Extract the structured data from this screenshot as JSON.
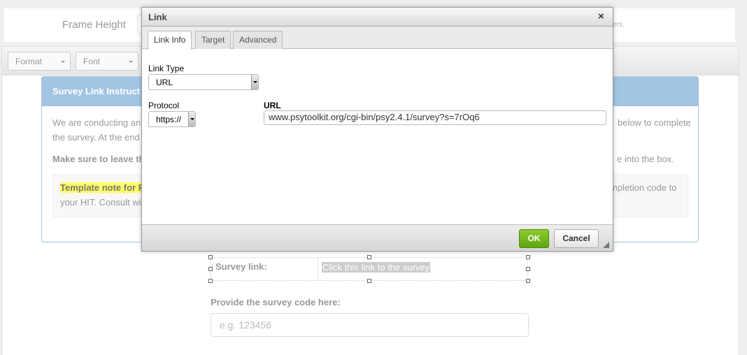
{
  "settings": {
    "frame_height_label": "Frame Height",
    "help_fragment": "ers."
  },
  "toolbar": {
    "format": "Format",
    "font": "Font"
  },
  "panel": {
    "title": "Survey Link Instruct",
    "line1_left": "We are conducting an",
    "line1_right": "below to complete",
    "line2_left": "the survey. At the end",
    "line3_left": "Make sure to leave th",
    "line3_right": "e into the box.",
    "note_left": "Template note for R",
    "note_right": "mpletion code to",
    "note2_left": "your HIT. Consult wi"
  },
  "survey": {
    "link_label": "Survey link:",
    "link_text": "Click this link to the survey",
    "code_label": "Provide the survey code here:",
    "code_placeholder": "e.g. 123456"
  },
  "dialog": {
    "title": "Link",
    "close": "×",
    "tabs": [
      {
        "label": "Link Info",
        "active": true
      },
      {
        "label": "Target"
      },
      {
        "label": "Advanced"
      }
    ],
    "link_type_label": "Link Type",
    "link_type_value": "URL",
    "protocol_label": "Protocol",
    "protocol_value": "https://",
    "url_label": "URL",
    "url_value": "www.psytoolkit.org/cgi-bin/psy2.4.1/survey?s=7rOq6",
    "ok": "OK",
    "cancel": "Cancel"
  },
  "colors": {
    "panel_header": "#a3c5e4",
    "ok_button": "#6fb41e",
    "highlight": "#ffff66"
  }
}
